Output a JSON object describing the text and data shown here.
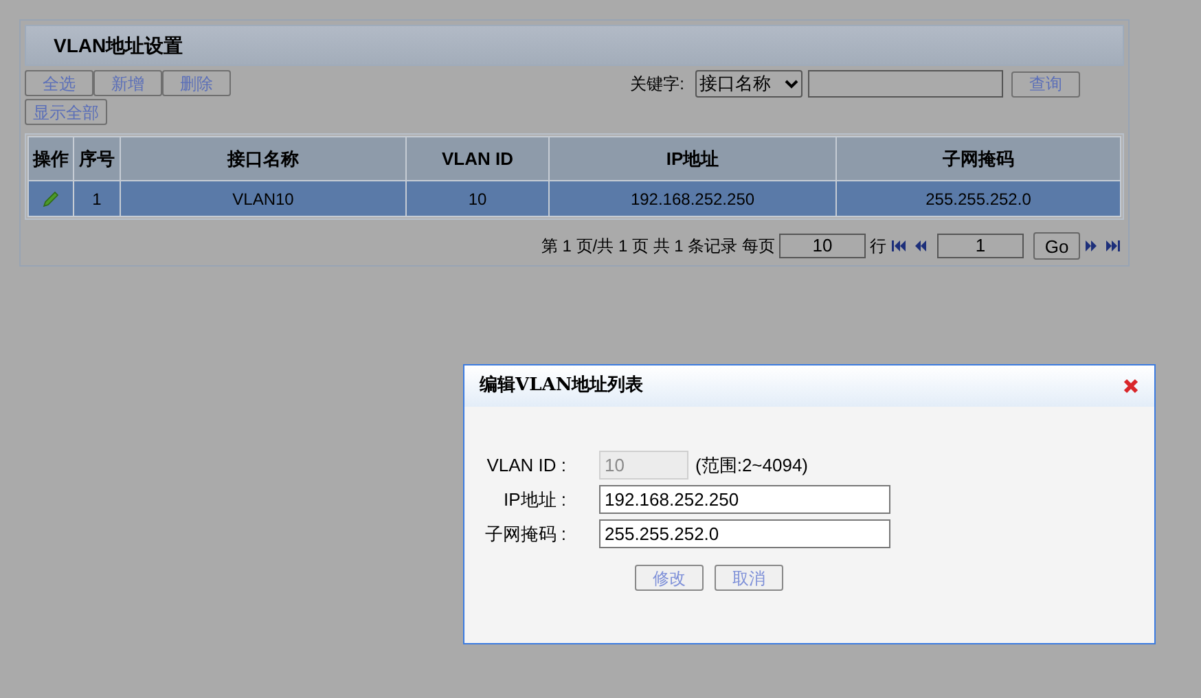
{
  "panel": {
    "title": "VLAN地址设置"
  },
  "toolbar": {
    "buttons": [
      "全选",
      "新增",
      "删除"
    ],
    "show_all": "显示全部"
  },
  "filter": {
    "label": "关键字:",
    "field": "接口名称",
    "button": "查询"
  },
  "table": {
    "columns": [
      "操作",
      "序号",
      "接口名称",
      "VLAN ID",
      "IP地址",
      "子网掩码"
    ],
    "rows": [
      {
        "selected": true,
        "cells": [
          "",
          "1",
          "VLAN10",
          "10",
          "192.168.252.250",
          "255.255.252.0"
        ]
      }
    ]
  },
  "pagination": {
    "summary": "第 1 页/共 1 页 共 1 条记录 每页",
    "page_size": "10",
    "rows_label": "行",
    "page": "1",
    "go": "Go"
  },
  "dialog": {
    "title": "编辑VLAN地址列表",
    "fields": [
      {
        "label": "VLAN ID :",
        "value": "10",
        "disabled": true,
        "hint": "(范围:2~4094)"
      },
      {
        "label": "IP地址 :",
        "value": "192.168.252.250",
        "disabled": false
      },
      {
        "label": "子网掩码 :",
        "value": "255.255.252.0",
        "disabled": false
      }
    ],
    "buttons": [
      "修改",
      "取消"
    ]
  }
}
